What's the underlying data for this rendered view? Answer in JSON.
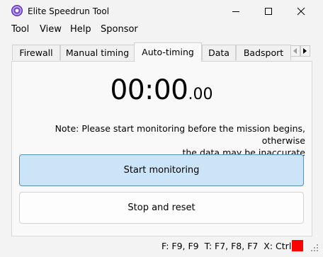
{
  "window": {
    "title": "Elite Speedrun Tool",
    "icon": "app-logo-icon"
  },
  "menu": {
    "items": [
      "Tool",
      "View",
      "Help",
      "Sponsor"
    ]
  },
  "tabs": {
    "items": [
      "Firewall",
      "Manual timing",
      "Auto-timing",
      "Data",
      "Badsport"
    ],
    "active": "Auto-timing"
  },
  "timer": {
    "main": "00:00",
    "fraction": ".00"
  },
  "note": {
    "line1": "Note: Please start monitoring before the mission begins, otherwise",
    "line2": "the data may be inaccurate"
  },
  "buttons": {
    "start_label": "Start monitoring",
    "stop_label": "Stop and reset"
  },
  "status": {
    "hotkeys": "F: F9, F9  T: F7, F8, F7  X: Ctrl+`",
    "indicator_color": "#ff0000"
  },
  "colors": {
    "accent_button_bg": "#cce4f7",
    "accent_button_border": "#5a8fbf"
  }
}
